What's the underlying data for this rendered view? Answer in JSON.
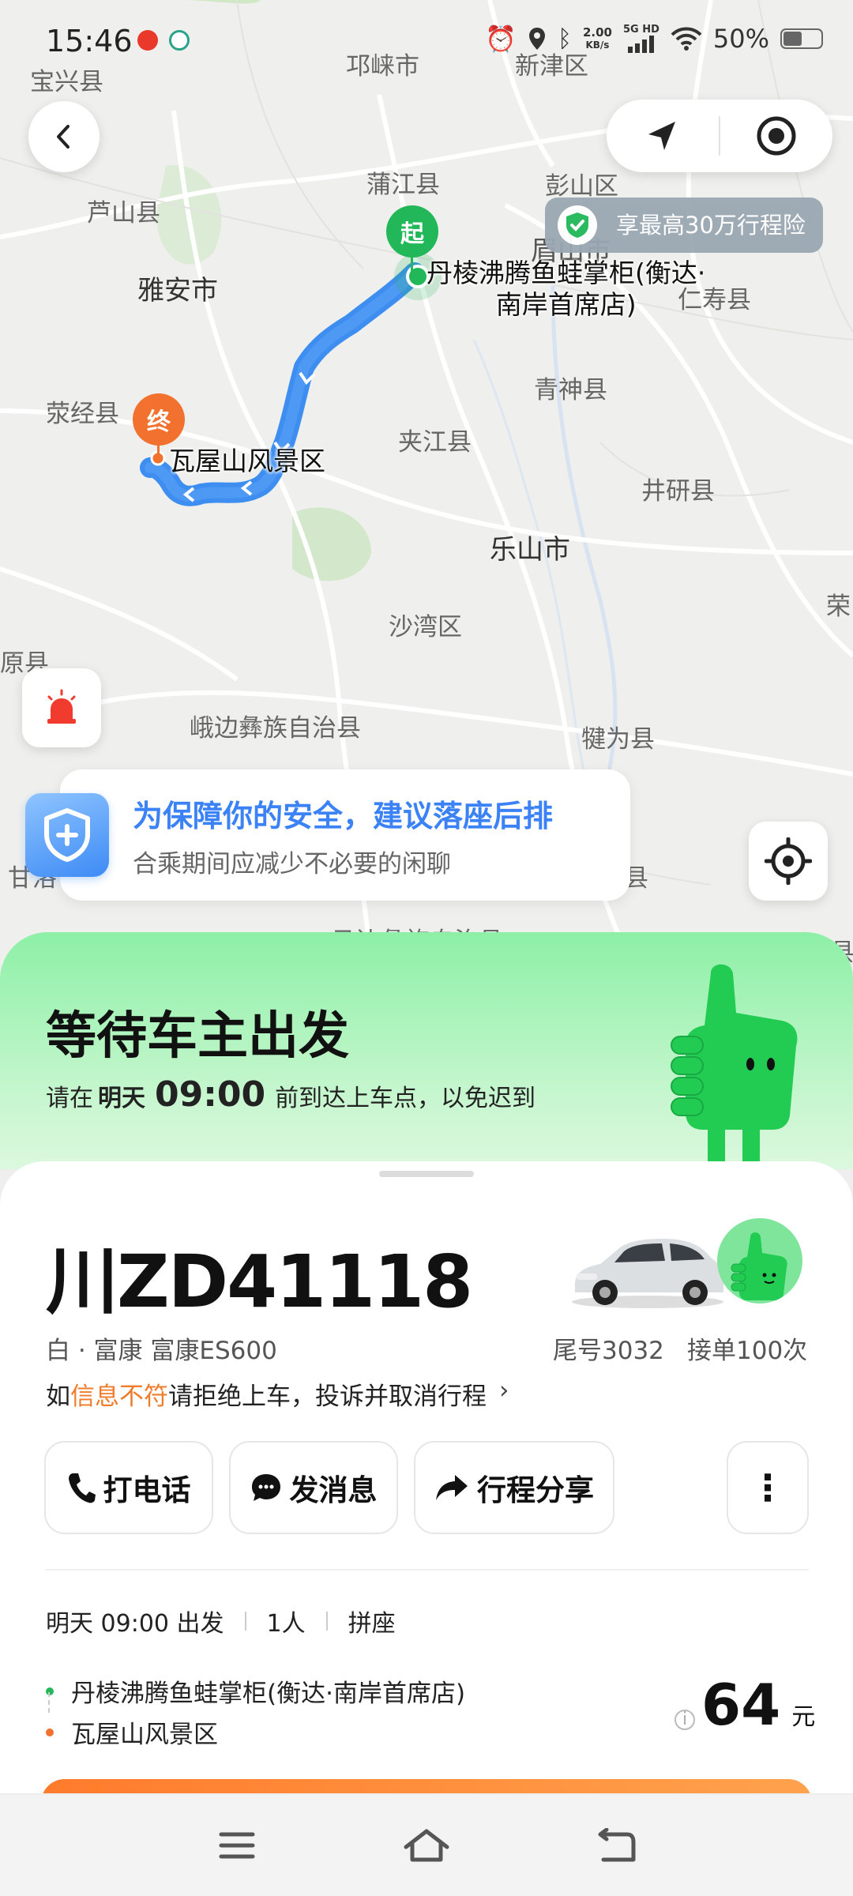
{
  "status_bar": {
    "time": "15:46",
    "net_speed_value": "2.00",
    "net_speed_unit": "KB/s",
    "network": "5G HD",
    "battery": "50%"
  },
  "map": {
    "places": {
      "qionglai": "邛崃市",
      "xinjin": "新津区",
      "baoxing": "宝兴县",
      "lushan": "芦山县",
      "pujiang": "蒲江县",
      "pengshan": "彭山区",
      "meishan_partial": "眉山市",
      "yaan": "雅安市",
      "renshou": "仁寿县",
      "qingshen": "青神县",
      "yingjing": "荥经县",
      "jiajiang": "夹江县",
      "jingyan": "井研县",
      "leshan": "乐山市",
      "rong_partial": "荣",
      "shawan": "沙湾区",
      "hanyuan_partial": "原县",
      "ebian": "峨边彝族自治县",
      "qianwei": "犍为县",
      "ganluo_partial": "甘洛",
      "mabian_partial": "县",
      "muchuan_partial": "马边彝族自治县",
      "pingshan_partial": "山县"
    },
    "start_pin_label": "起",
    "end_pin_label": "终",
    "start_poi_line1": "丹棱沸腾鱼蛙掌柜(衡达·",
    "start_poi_line2": "南岸首席店)",
    "end_poi": "瓦屋山风景区",
    "insurance_text": "享最高30万行程险",
    "safety_title": "为保障你的安全，建议落座后排",
    "safety_sub": "合乘期间应减少不必要的闲聊",
    "colors": {
      "route": "#3d8ef0",
      "start": "#22b85a",
      "end": "#f2712e"
    }
  },
  "hero": {
    "title": "等待车主出发",
    "sub_prefix": "请在",
    "sub_day": "明天",
    "sub_time": "09:00",
    "sub_suffix": "前到达上车点，以免迟到"
  },
  "vehicle": {
    "plate": "川ZD41118",
    "desc": "白 · 富康 富康ES600",
    "tail_number": "尾号3032",
    "order_count": "接单100次",
    "notice_prefix": "如",
    "notice_highlight": "信息不符",
    "notice_suffix": "请拒绝上车，投诉并取消行程",
    "notice_arrow": "›"
  },
  "actions": {
    "call": "打电话",
    "message": "发消息",
    "share": "行程分享",
    "more": "⋮"
  },
  "trip": {
    "depart": "明天 09:00 出发",
    "people": "1人",
    "type": "拼座",
    "from": "丹棱沸腾鱼蛙掌柜(衡达·南岸首席店)",
    "to": "瓦屋山风景区",
    "price": "64",
    "price_unit": "元",
    "price_info": "i"
  },
  "nav": {
    "menu_icon": "menu-icon",
    "home_icon": "home-icon",
    "back_icon": "back-icon"
  }
}
